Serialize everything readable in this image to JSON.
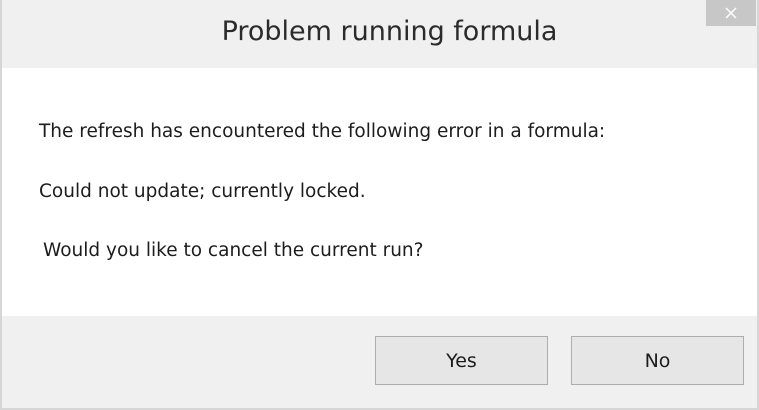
{
  "dialog": {
    "title": "Problem running formula",
    "close_icon": "close-icon",
    "messages": [
      "The refresh has encountered the following error in a formula:",
      "Could not update; currently locked.",
      "Would you like to cancel the current run?"
    ],
    "buttons": {
      "yes_label": "Yes",
      "no_label": "No"
    }
  }
}
